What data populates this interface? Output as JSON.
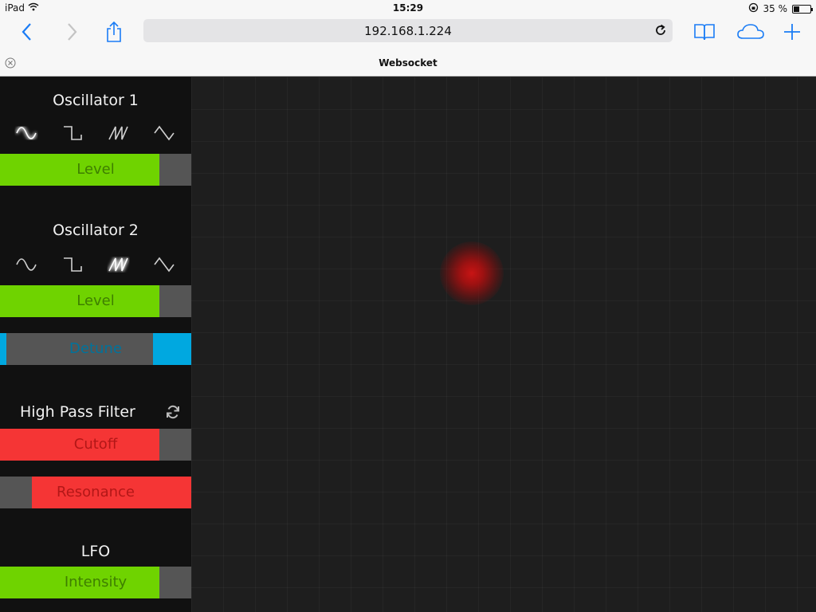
{
  "status": {
    "device": "iPad",
    "time": "15:29",
    "battery": "35 %",
    "battery_fraction": 0.35
  },
  "browser": {
    "url": "192.168.1.224",
    "tab_title": "Websocket"
  },
  "synth": {
    "osc1": {
      "title": "Oscillator 1",
      "waves": [
        "sine",
        "square",
        "sawtooth",
        "triangle"
      ],
      "selected": "sine",
      "level": {
        "label": "Level",
        "value": 0.833,
        "fill_from": "left"
      }
    },
    "osc2": {
      "title": "Oscillator 2",
      "waves": [
        "sine",
        "square",
        "sawtooth",
        "triangle"
      ],
      "selected": "sawtooth",
      "level": {
        "label": "Level",
        "value": 0.833,
        "fill_from": "left"
      },
      "detune": {
        "label": "Detune",
        "value": 0.2,
        "fill_from": "right"
      }
    },
    "hpf": {
      "title": "High Pass Filter",
      "cutoff": {
        "label": "Cutoff",
        "value": 0.833,
        "fill_from": "left"
      },
      "resonance": {
        "label": "Resonance",
        "value": 0.833,
        "fill_from": "right"
      }
    },
    "lfo": {
      "title": "LFO",
      "intensity": {
        "label": "Intensity",
        "value": 0.833,
        "fill_from": "left"
      }
    }
  },
  "colors": {
    "green": "#6fd300",
    "red": "#f53535",
    "blue": "#00a8e0",
    "accent": "#1a7cf5",
    "pad_dot": "#c81414"
  }
}
